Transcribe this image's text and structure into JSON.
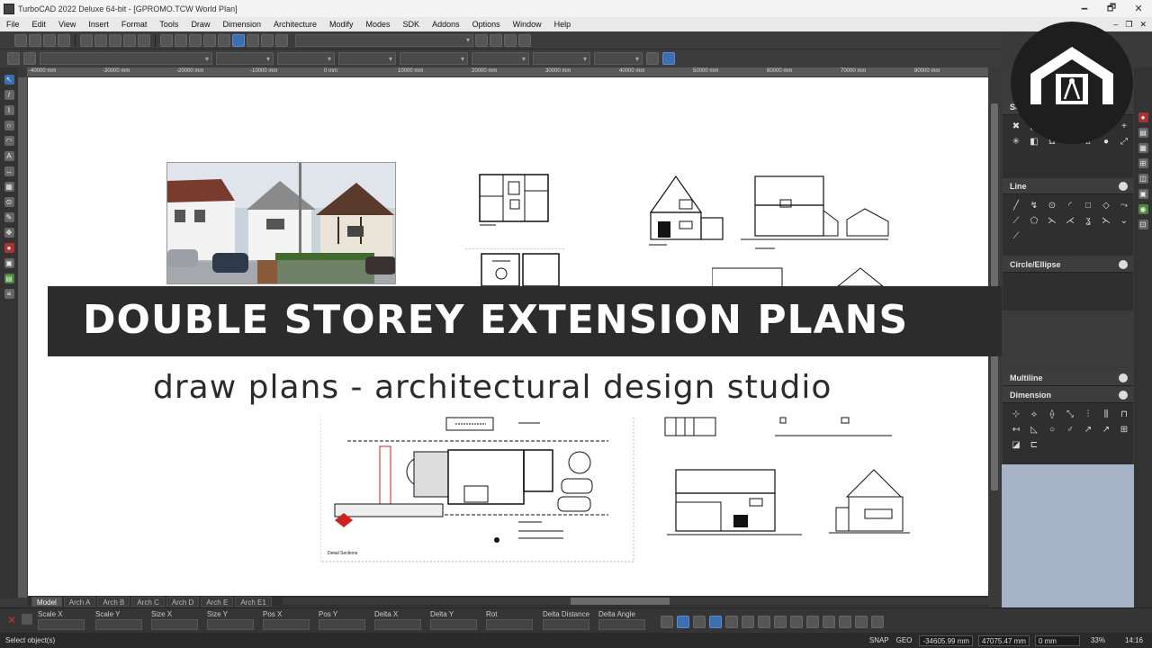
{
  "window": {
    "title": "TurboCAD 2022 Deluxe 64-bit - [GPROMO.TCW World Plan]",
    "controls": [
      "🗕",
      "🗗",
      "✕"
    ]
  },
  "menu": [
    "File",
    "Edit",
    "View",
    "Insert",
    "Format",
    "Tools",
    "Draw",
    "Dimension",
    "Architecture",
    "Modify",
    "Modes",
    "SDK",
    "Addons",
    "Options",
    "Window",
    "Help"
  ],
  "ruler_marks": [
    "-40000 mm",
    "-30000 mm",
    "-20000 mm",
    "-10000 mm",
    "0 mm",
    "10000 mm",
    "20000 mm",
    "30000 mm",
    "40000 mm",
    "50000 mm",
    "60000 mm",
    "70000 mm",
    "80000 mm"
  ],
  "banner": {
    "title": "DOUBLE STOREY EXTENSION PLANS",
    "subtitle": "draw plans - architectural design studio"
  },
  "palette": {
    "sections": [
      "Line",
      "Circle/Ellipse",
      "Multiline",
      "Dimension"
    ],
    "stray_label": "Se"
  },
  "tabs": [
    "Model",
    "Arch A",
    "Arch B",
    "Arch C",
    "Arch D",
    "Arch E",
    "Arch E1"
  ],
  "inspector": {
    "fields": [
      "Scale X",
      "Scale Y",
      "Size X",
      "Size Y",
      "Pos X",
      "Pos Y",
      "Delta X",
      "Delta Y",
      "Rot",
      "Delta Distance",
      "Delta Angle"
    ]
  },
  "status": {
    "message": "Select object(s)",
    "snap": "SNAP",
    "geo": "GEO",
    "coord_x": "-34605.99 mm",
    "coord_y": "47075.47 mm",
    "coord_z": "0 mm",
    "zoom": "33%",
    "time": "14:16"
  },
  "drawing_label": "Detail Sections"
}
